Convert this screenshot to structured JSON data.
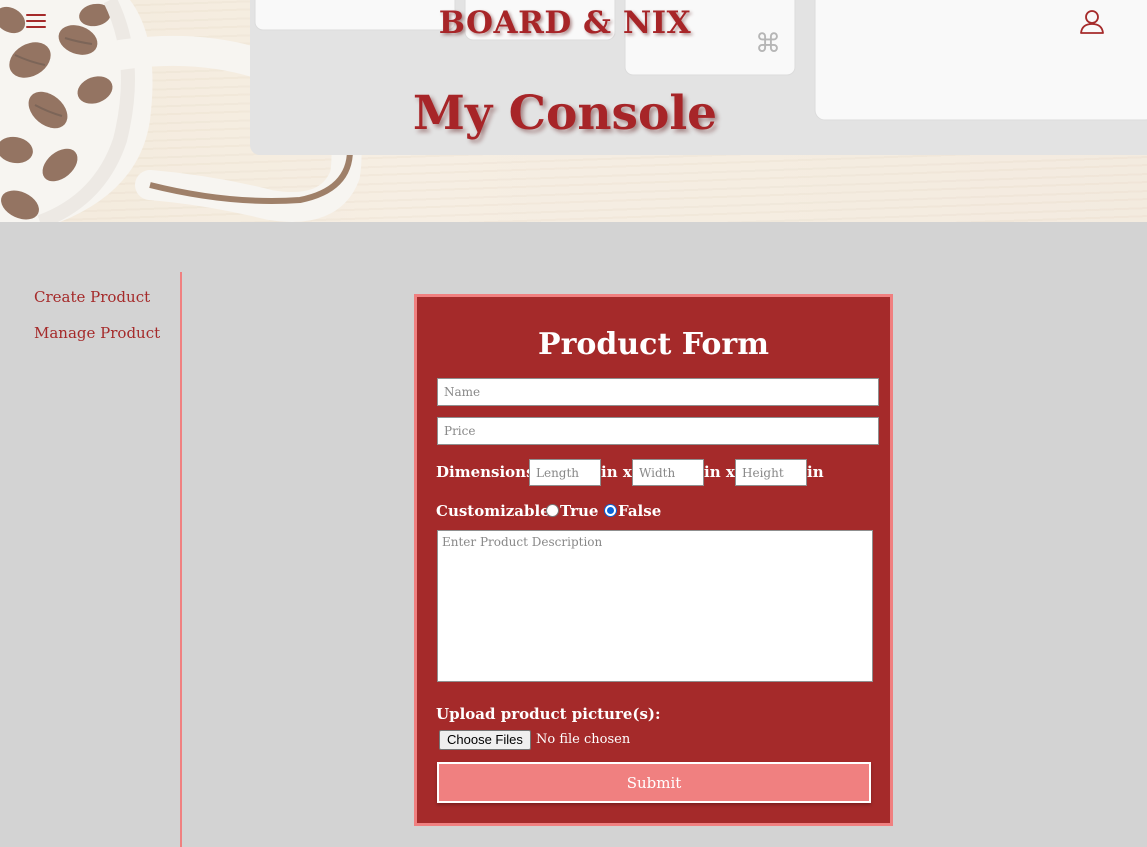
{
  "header": {
    "brand": "BOARD & NIX",
    "title": "My Console"
  },
  "sidebar": {
    "items": [
      {
        "label": "Create Product"
      },
      {
        "label": "Manage Product"
      }
    ]
  },
  "form": {
    "title": "Product Form",
    "name_placeholder": "Name",
    "price_placeholder": "Price",
    "dimensions_label": "Dimensions:",
    "length_placeholder": "Length",
    "width_placeholder": "Width",
    "height_placeholder": "Height",
    "unit_x": "in x",
    "unit": "in",
    "customizable_label": "Customizable:",
    "option_true": "True",
    "option_false": "False",
    "selected_option": "False",
    "description_placeholder": "Enter Product Description",
    "upload_label": "Upload product picture(s):",
    "choose_files_label": "Choose Files",
    "file_status": "No file chosen",
    "submit_label": "Submit"
  },
  "colors": {
    "accent": "#a52a2a",
    "accent_light": "#f08080",
    "background": "#d3d3d3"
  },
  "icons": {
    "menu": "hamburger-menu-icon",
    "user": "user-icon"
  }
}
